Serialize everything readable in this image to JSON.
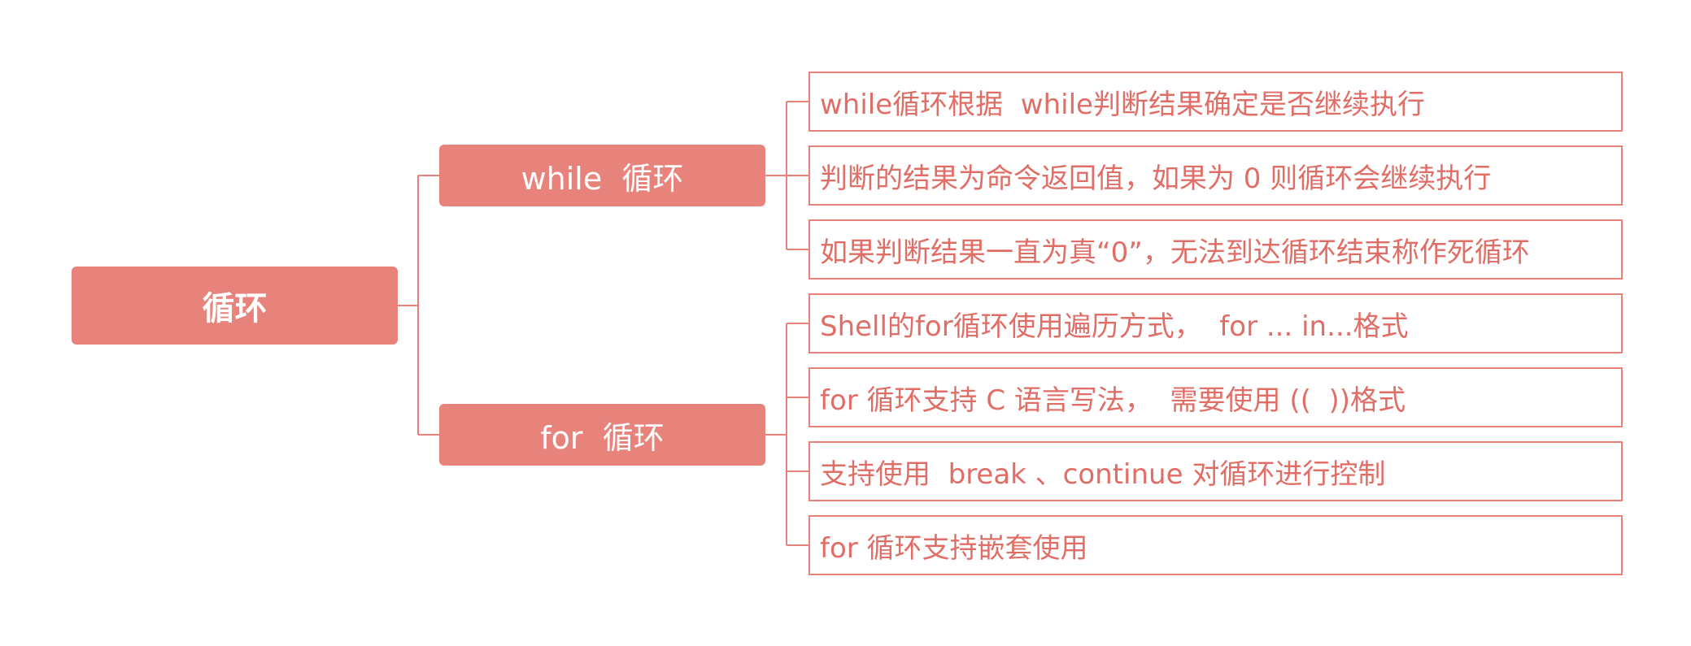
{
  "colors": {
    "node_fill": "#e8837b",
    "node_text": "#ffffff",
    "leaf_border": "#e8837b",
    "leaf_text": "#e06e66",
    "connector": "#e8837b"
  },
  "root": {
    "label": "循环"
  },
  "branches": [
    {
      "label": "while  循环",
      "items": [
        "while循环根据  while判断结果确定是否继续执行",
        "判断的结果为命令返回值，如果为 0 则循环会继续执行",
        "如果判断结果一直为真“0”，无法到达循环结束称作死循环"
      ]
    },
    {
      "label": "for  循环",
      "items": [
        "Shell的for循环使用遍历方式，  for ... in...格式",
        "for 循环支持 C 语言写法，  需要使用 ((  ))格式",
        "支持使用  break 、continue 对循环进行控制",
        "for 循环支持嵌套使用"
      ]
    }
  ]
}
